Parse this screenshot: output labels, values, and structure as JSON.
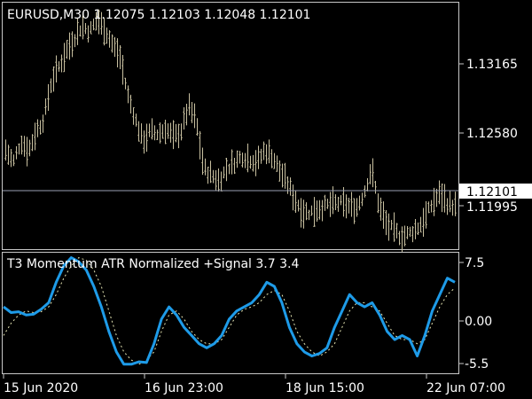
{
  "main_panel": {
    "title": "EURUSD,M30  1.12075 1.12103 1.12048 1.12101",
    "price_ticks": [
      "1.13165",
      "1.12580",
      "1.11995"
    ],
    "current_price": "1.12101",
    "colors": {
      "bars": "#c8c0a0",
      "price_line": "#9aa0b4"
    },
    "price_range": [
      1.1176,
      1.1372
    ]
  },
  "indicator_panel": {
    "title": "T3 Momentum ATR Normalized +Signal 3.7 3.4",
    "ticks": [
      "7.5",
      "0.00",
      "-5.5"
    ],
    "range": [
      -6.5,
      8.0
    ],
    "colors": {
      "main_line": "#1e9be8",
      "signal_line": "#e6e6b4"
    }
  },
  "time_axis": {
    "labels": [
      "15 Jun 2020",
      "16 Jun 23:00",
      "18 Jun 15:00",
      "22 Jun 07:00"
    ]
  },
  "chart_data": {
    "type": "line",
    "panels": [
      {
        "name": "price",
        "kind": "ohlc",
        "y_ticks": [
          1.13165,
          1.1258,
          1.11995
        ],
        "current": 1.12101,
        "close_path": [
          1.1255,
          1.1245,
          1.1262,
          1.1254,
          1.127,
          1.128,
          1.131,
          1.1322,
          1.1335,
          1.1345,
          1.1355,
          1.135,
          1.136,
          1.1352,
          1.134,
          1.133,
          1.13,
          1.128,
          1.1262,
          1.127,
          1.1268,
          1.1272,
          1.1265,
          1.127,
          1.129,
          1.1278,
          1.124,
          1.1235,
          1.123,
          1.124,
          1.1245,
          1.125,
          1.1248,
          1.1245,
          1.1255,
          1.125,
          1.1238,
          1.1228,
          1.1215,
          1.1205,
          1.1205,
          1.1208,
          1.121,
          1.1212,
          1.1212,
          1.121,
          1.1208,
          1.122,
          1.124,
          1.121,
          1.1195,
          1.119,
          1.1185,
          1.1188,
          1.1192,
          1.12,
          1.1212,
          1.122,
          1.1212,
          1.121
        ]
      },
      {
        "name": "indicator",
        "y_ticks": [
          7.5,
          0.0,
          -5.5
        ],
        "series": [
          {
            "name": "T3 Momentum",
            "values": [
              1.5,
              0.8,
              0.9,
              0.5,
              0.6,
              1.2,
              2.0,
              4.5,
              6.5,
              7.5,
              7.0,
              6.0,
              4.0,
              1.5,
              -1.5,
              -4.0,
              -5.5,
              -5.5,
              -5.2,
              -5.3,
              -3.0,
              0.0,
              1.5,
              0.5,
              -1.0,
              -2.0,
              -3.0,
              -3.5,
              -3.0,
              -2.0,
              0.0,
              1.0,
              1.5,
              2.0,
              3.0,
              4.5,
              4.0,
              2.0,
              -1.0,
              -3.0,
              -4.0,
              -4.5,
              -4.2,
              -3.5,
              -1.0,
              1.0,
              3.0,
              2.0,
              1.5,
              2.0,
              0.5,
              -1.5,
              -2.5,
              -2.0,
              -2.5,
              -4.5,
              -2.0,
              1.0,
              3.0,
              5.0,
              4.5
            ]
          },
          {
            "name": "Signal",
            "values": [
              -2.0,
              -0.5,
              0.5,
              1.0,
              0.8,
              0.9,
              1.5,
              3.0,
              5.0,
              6.5,
              7.5,
              7.2,
              6.0,
              4.0,
              1.0,
              -2.0,
              -4.0,
              -5.0,
              -5.5,
              -5.0,
              -4.0,
              -1.5,
              0.5,
              1.0,
              0.0,
              -1.5,
              -2.5,
              -3.0,
              -3.0,
              -2.5,
              -1.0,
              0.5,
              1.2,
              1.5,
              2.0,
              3.0,
              3.5,
              3.0,
              1.0,
              -1.5,
              -3.0,
              -4.0,
              -4.5,
              -4.0,
              -3.0,
              -1.0,
              1.0,
              2.0,
              2.0,
              1.5,
              1.0,
              -0.5,
              -2.0,
              -2.5,
              -2.5,
              -3.0,
              -2.5,
              -0.5,
              1.5,
              3.0,
              3.8
            ]
          }
        ]
      }
    ]
  }
}
